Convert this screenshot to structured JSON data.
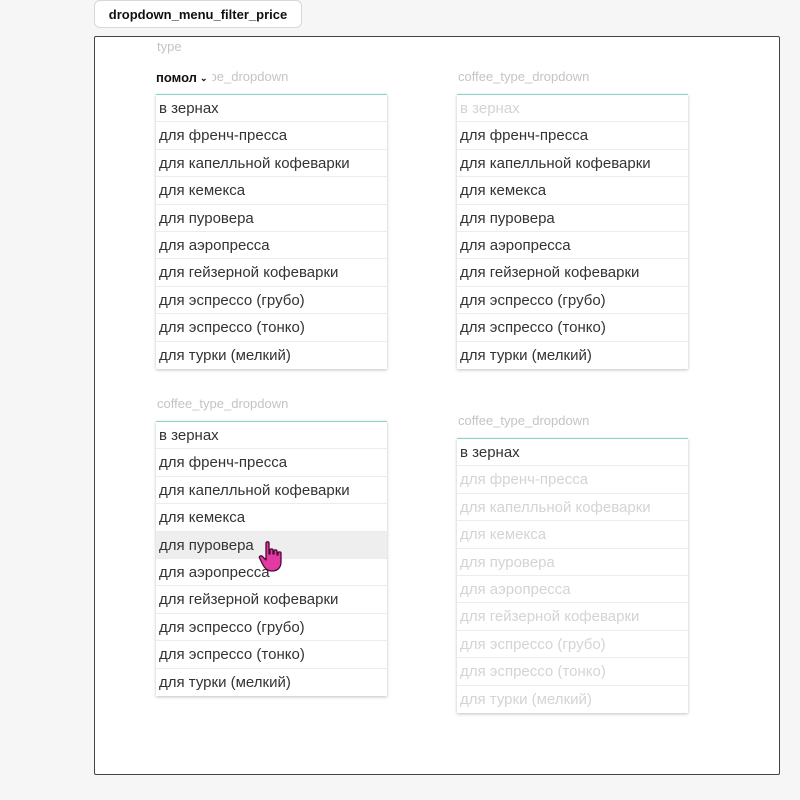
{
  "tab_label": "dropdown_menu_filter_price",
  "type_label": "type",
  "pomol_label": "помол",
  "dropdowns": [
    {
      "label": "coffee_type_dropdown",
      "items": [
        "в зернах",
        "для френч-пресса",
        "для капелльной кофеварки",
        "для кемекса",
        "для пуровера",
        "для аэропресса",
        "для гейзерной кофеварки",
        "для эспрессо (грубо)",
        "для эспрессо (тонко)",
        "для турки (мелкий)"
      ]
    },
    {
      "label": "coffee_type_dropdown",
      "items": [
        "в зернах",
        "для френч-пресса",
        "для капелльной кофеварки",
        "для кемекса",
        "для пуровера",
        "для аэропресса",
        "для гейзерной кофеварки",
        "для эспрессо (грубо)",
        "для эспрессо (тонко)",
        "для турки (мелкий)"
      ]
    },
    {
      "label": "coffee_type_dropdown",
      "items": [
        "в зернах",
        "для френч-пресса",
        "для капелльной кофеварки",
        "для кемекса",
        "для пуровера",
        "для аэропресса",
        "для гейзерной кофеварки",
        "для эспрессо (грубо)",
        "для эспрессо (тонко)",
        "для турки (мелкий)"
      ]
    },
    {
      "label": "coffee_type_dropdown",
      "items": [
        "в зернах",
        "для френч-пресса",
        "для капелльной кофеварки",
        "для кемекса",
        "для пуровера",
        "для аэропресса",
        "для гейзерной кофеварки",
        "для эспрессо (грубо)",
        "для эспрессо (тонко)",
        "для турки (мелкий)"
      ]
    }
  ],
  "colors": {
    "accent_border": "#86d6cc",
    "cursor": "#e23aa3",
    "dim_text": "#d4d4d4"
  },
  "icons": {
    "cursor": "hand-pointer-icon",
    "chevron": "chevron-down-icon"
  }
}
